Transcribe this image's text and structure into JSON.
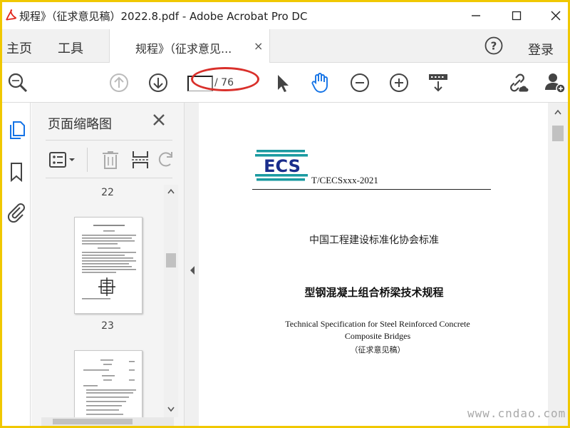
{
  "window": {
    "title": "规程》（征求意见稿）2022.8.pdf - Adobe Acrobat Pro DC"
  },
  "menubar": {
    "home": "主页",
    "tools": "工具",
    "tab_label": "规程》（征求意见...",
    "tab_close": "×",
    "login": "登录"
  },
  "toolbar": {
    "page_current": "",
    "page_total": "/ 76"
  },
  "thumbnails": {
    "title": "页面缩略图",
    "pages": [
      {
        "label": "22"
      },
      {
        "label": "23"
      }
    ]
  },
  "document": {
    "logo_text": "ECS",
    "standard_code": "T/CECSxxx-2021",
    "association": "中国工程建设标准化协会标准",
    "title_cn": "型钢混凝土组合桥梁技术规程",
    "title_en_line1": "Technical Specification for Steel Reinforced Concrete",
    "title_en_line2": "Composite Bridges",
    "draft": "（征求意见稿）"
  },
  "watermark": "www.cndao.com",
  "colors": {
    "frame": "#f0c800",
    "accent_blue": "#1473e6",
    "highlight_red": "#d9302b",
    "logo_teal": "#1a9aa0",
    "logo_blue": "#1a2e8c"
  }
}
